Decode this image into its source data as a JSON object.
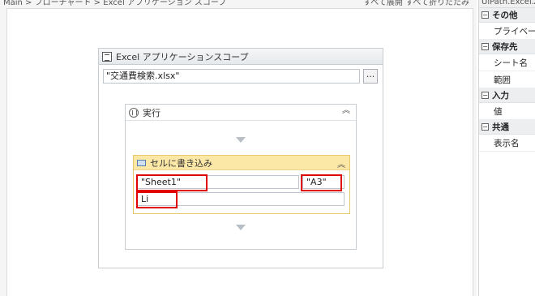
{
  "designer": {
    "breadcrumb": "Main > フローチャート > Excel アプリケーション スコープ",
    "top_right_text": "すべて展開 すべて折りたたみ"
  },
  "scope": {
    "title": "Excel アプリケーションスコープ",
    "workbook_path": "\"交通費検索.xlsx\"",
    "browse_label": "..."
  },
  "sequence": {
    "title": "実行"
  },
  "write_cell": {
    "title": "セルに書き込み",
    "sheet_value": "\"Sheet1\"",
    "cell_value": "\"A3\"",
    "input_value": "Li"
  },
  "properties": {
    "header": "UiPath.Excel.Activities",
    "categories": [
      {
        "label": "その他",
        "toggle": "⊟",
        "items": [
          "プライベート"
        ]
      },
      {
        "label": "保存先",
        "toggle": "⊟",
        "items": [
          "シート名",
          "範囲"
        ]
      },
      {
        "label": "入力",
        "toggle": "⊟",
        "items": [
          "値"
        ]
      },
      {
        "label": "共通",
        "toggle": "⊟",
        "items": [
          "表示名"
        ]
      }
    ]
  },
  "colors": {
    "highlight": "#e00000",
    "activity_header": "#fce8a6"
  }
}
